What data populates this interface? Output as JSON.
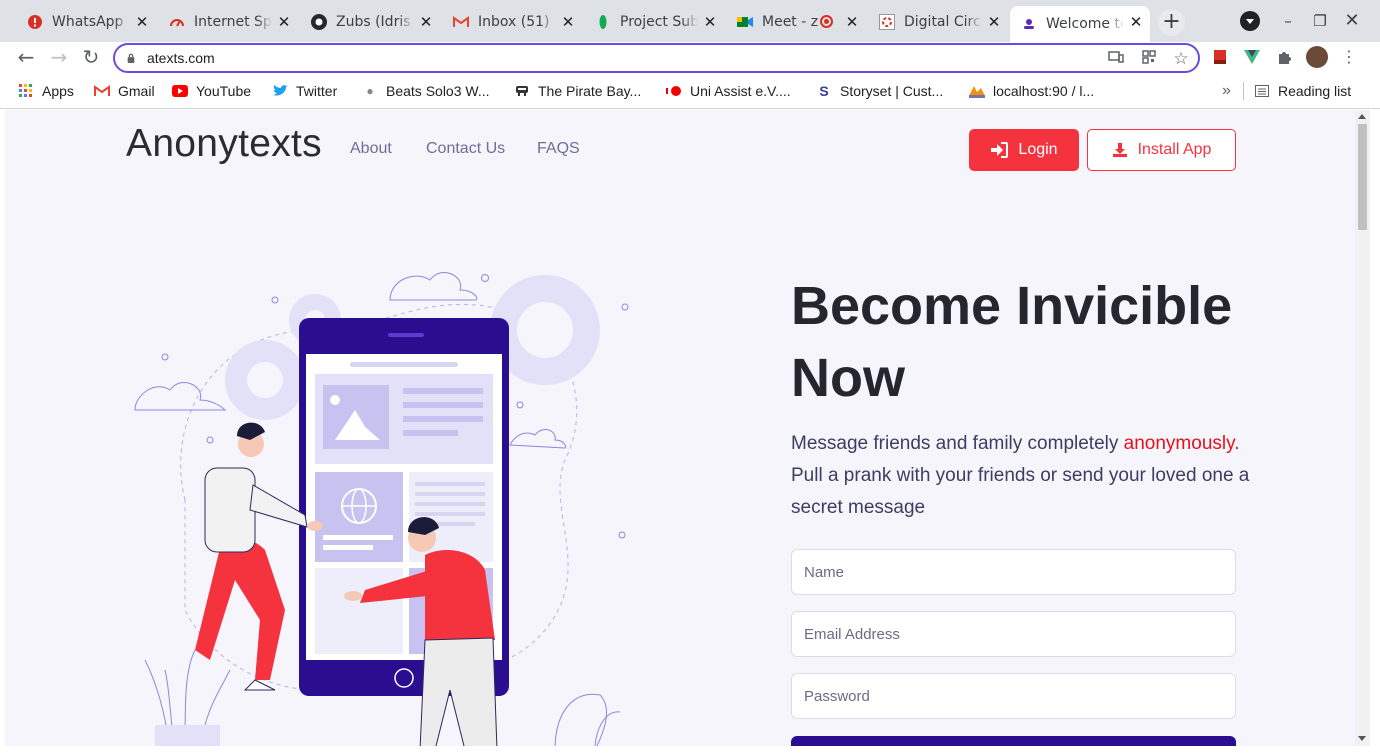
{
  "browser": {
    "tabs": [
      {
        "title": "WhatsApp",
        "icon": "whatsapp-alert-icon",
        "active": false
      },
      {
        "title": "Internet Speed Test",
        "icon": "speedtest-icon",
        "active": false
      },
      {
        "title": "Zubs (Idris",
        "icon": "github-icon",
        "active": false
      },
      {
        "title": "Inbox (51) -",
        "icon": "gmail-icon",
        "active": false
      },
      {
        "title": "Project Sub",
        "icon": "mongodb-leaf-icon",
        "active": false
      },
      {
        "title": "Meet - z",
        "icon": "google-meet-icon",
        "active": false
      },
      {
        "title": "Digital Circ",
        "icon": "digital-circle-icon",
        "active": false
      },
      {
        "title": "Welcome to",
        "icon": "anonytexts-icon",
        "active": true
      }
    ],
    "address": "atexts.com",
    "bookmarks": [
      {
        "label": "Apps",
        "icon": "apps-grid-icon"
      },
      {
        "label": "Gmail",
        "icon": "gmail-icon"
      },
      {
        "label": "YouTube",
        "icon": "youtube-icon"
      },
      {
        "label": "Twitter",
        "icon": "twitter-icon"
      },
      {
        "label": "Beats Solo3 W...",
        "icon": "apple-icon"
      },
      {
        "label": "The Pirate Bay...",
        "icon": "pirate-ship-icon"
      },
      {
        "label": "Uni Assist e.V....",
        "icon": "uni-assist-icon"
      },
      {
        "label": "Storyset | Cust...",
        "icon": "storyset-icon"
      },
      {
        "label": "localhost:90 / l...",
        "icon": "phpmyadmin-icon"
      }
    ],
    "overflow_label": "»",
    "reading_list_label": "Reading list"
  },
  "page": {
    "logo": "Anonytexts",
    "nav": [
      "About",
      "Contact Us",
      "FAQS"
    ],
    "login_label": "Login",
    "install_label": "Install App",
    "hero_title_line1": "Become Invicible",
    "hero_title_line2": "Now",
    "hero_text_before": "Message friends and family completely ",
    "hero_text_highlight": "anonymously.",
    "hero_text_after": " Pull a prank with your friends or send your loved one a secret message",
    "form": {
      "name_placeholder": "Name",
      "email_placeholder": "Email Address",
      "password_placeholder": "Password"
    },
    "colors": {
      "accent": "#f5333f",
      "primary_dark": "#2a0e8f",
      "highlight": "#e8101b"
    }
  }
}
